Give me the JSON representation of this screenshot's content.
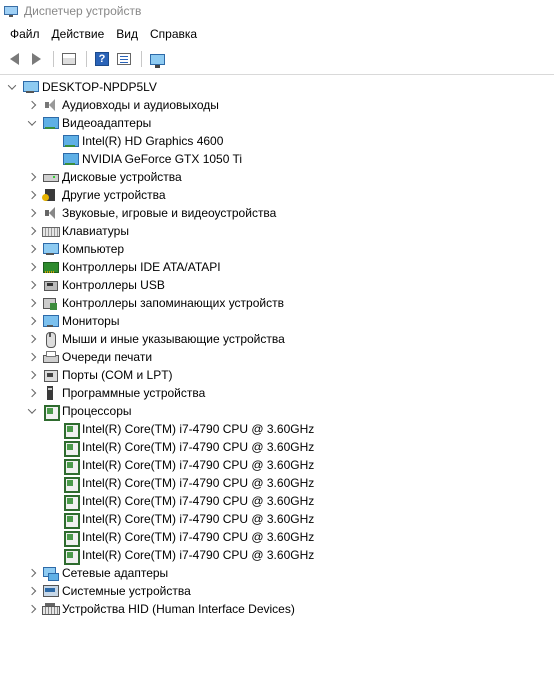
{
  "window": {
    "title": "Диспетчер устройств"
  },
  "menu": [
    {
      "label": "Файл"
    },
    {
      "label": "Действие"
    },
    {
      "label": "Вид"
    },
    {
      "label": "Справка"
    }
  ],
  "toolbar": {
    "buttons": [
      {
        "name": "back-icon"
      },
      {
        "name": "forward-icon"
      },
      {
        "name": "show-hide-console-tree-icon"
      },
      {
        "name": "help-icon"
      },
      {
        "name": "properties-icon"
      },
      {
        "name": "scan-hardware-icon"
      }
    ]
  },
  "tree": {
    "root": {
      "label": "DESKTOP-NPDP5LV",
      "icon": "computer-icon",
      "expanded": true
    },
    "items": [
      {
        "label": "Аудиовходы и аудиовыходы",
        "icon": "audio-icon",
        "level": 1,
        "state": "collapsed"
      },
      {
        "label": "Видеоадаптеры",
        "icon": "display-adapter-icon",
        "level": 1,
        "state": "expanded"
      },
      {
        "label": "Intel(R) HD Graphics 4600",
        "icon": "display-adapter-icon",
        "level": 2,
        "state": "leaf"
      },
      {
        "label": "NVIDIA GeForce GTX 1050 Ti",
        "icon": "display-adapter-icon",
        "level": 2,
        "state": "leaf"
      },
      {
        "label": "Дисковые устройства",
        "icon": "disk-icon",
        "level": 1,
        "state": "collapsed"
      },
      {
        "label": "Другие устройства",
        "icon": "other-device-icon",
        "level": 1,
        "state": "collapsed"
      },
      {
        "label": "Звуковые, игровые и видеоустройства",
        "icon": "sound-icon",
        "level": 1,
        "state": "collapsed"
      },
      {
        "label": "Клавиатуры",
        "icon": "keyboard-icon",
        "level": 1,
        "state": "collapsed"
      },
      {
        "label": "Компьютер",
        "icon": "computer-icon",
        "level": 1,
        "state": "collapsed"
      },
      {
        "label": "Контроллеры IDE ATA/ATAPI",
        "icon": "ide-controller-icon",
        "level": 1,
        "state": "collapsed"
      },
      {
        "label": "Контроллеры USB",
        "icon": "usb-icon",
        "level": 1,
        "state": "collapsed"
      },
      {
        "label": "Контроллеры запоминающих устройств",
        "icon": "storage-controller-icon",
        "level": 1,
        "state": "collapsed"
      },
      {
        "label": "Мониторы",
        "icon": "monitor-icon",
        "level": 1,
        "state": "collapsed"
      },
      {
        "label": "Мыши и иные указывающие устройства",
        "icon": "mouse-icon",
        "level": 1,
        "state": "collapsed"
      },
      {
        "label": "Очереди печати",
        "icon": "printer-icon",
        "level": 1,
        "state": "collapsed"
      },
      {
        "label": "Порты (COM и LPT)",
        "icon": "port-icon",
        "level": 1,
        "state": "collapsed"
      },
      {
        "label": "Программные устройства",
        "icon": "firmware-icon",
        "level": 1,
        "state": "collapsed"
      },
      {
        "label": "Процессоры",
        "icon": "cpu-icon",
        "level": 1,
        "state": "expanded"
      },
      {
        "label": "Intel(R) Core(TM) i7-4790 CPU @ 3.60GHz",
        "icon": "cpu-icon",
        "level": 2,
        "state": "leaf"
      },
      {
        "label": "Intel(R) Core(TM) i7-4790 CPU @ 3.60GHz",
        "icon": "cpu-icon",
        "level": 2,
        "state": "leaf"
      },
      {
        "label": "Intel(R) Core(TM) i7-4790 CPU @ 3.60GHz",
        "icon": "cpu-icon",
        "level": 2,
        "state": "leaf"
      },
      {
        "label": "Intel(R) Core(TM) i7-4790 CPU @ 3.60GHz",
        "icon": "cpu-icon",
        "level": 2,
        "state": "leaf"
      },
      {
        "label": "Intel(R) Core(TM) i7-4790 CPU @ 3.60GHz",
        "icon": "cpu-icon",
        "level": 2,
        "state": "leaf"
      },
      {
        "label": "Intel(R) Core(TM) i7-4790 CPU @ 3.60GHz",
        "icon": "cpu-icon",
        "level": 2,
        "state": "leaf"
      },
      {
        "label": "Intel(R) Core(TM) i7-4790 CPU @ 3.60GHz",
        "icon": "cpu-icon",
        "level": 2,
        "state": "leaf"
      },
      {
        "label": "Intel(R) Core(TM) i7-4790 CPU @ 3.60GHz",
        "icon": "cpu-icon",
        "level": 2,
        "state": "leaf"
      },
      {
        "label": "Сетевые адаптеры",
        "icon": "network-adapter-icon",
        "level": 1,
        "state": "collapsed"
      },
      {
        "label": "Системные устройства",
        "icon": "system-device-icon",
        "level": 1,
        "state": "collapsed"
      },
      {
        "label": "Устройства HID (Human Interface Devices)",
        "icon": "hid-icon",
        "level": 1,
        "state": "collapsed"
      }
    ]
  }
}
